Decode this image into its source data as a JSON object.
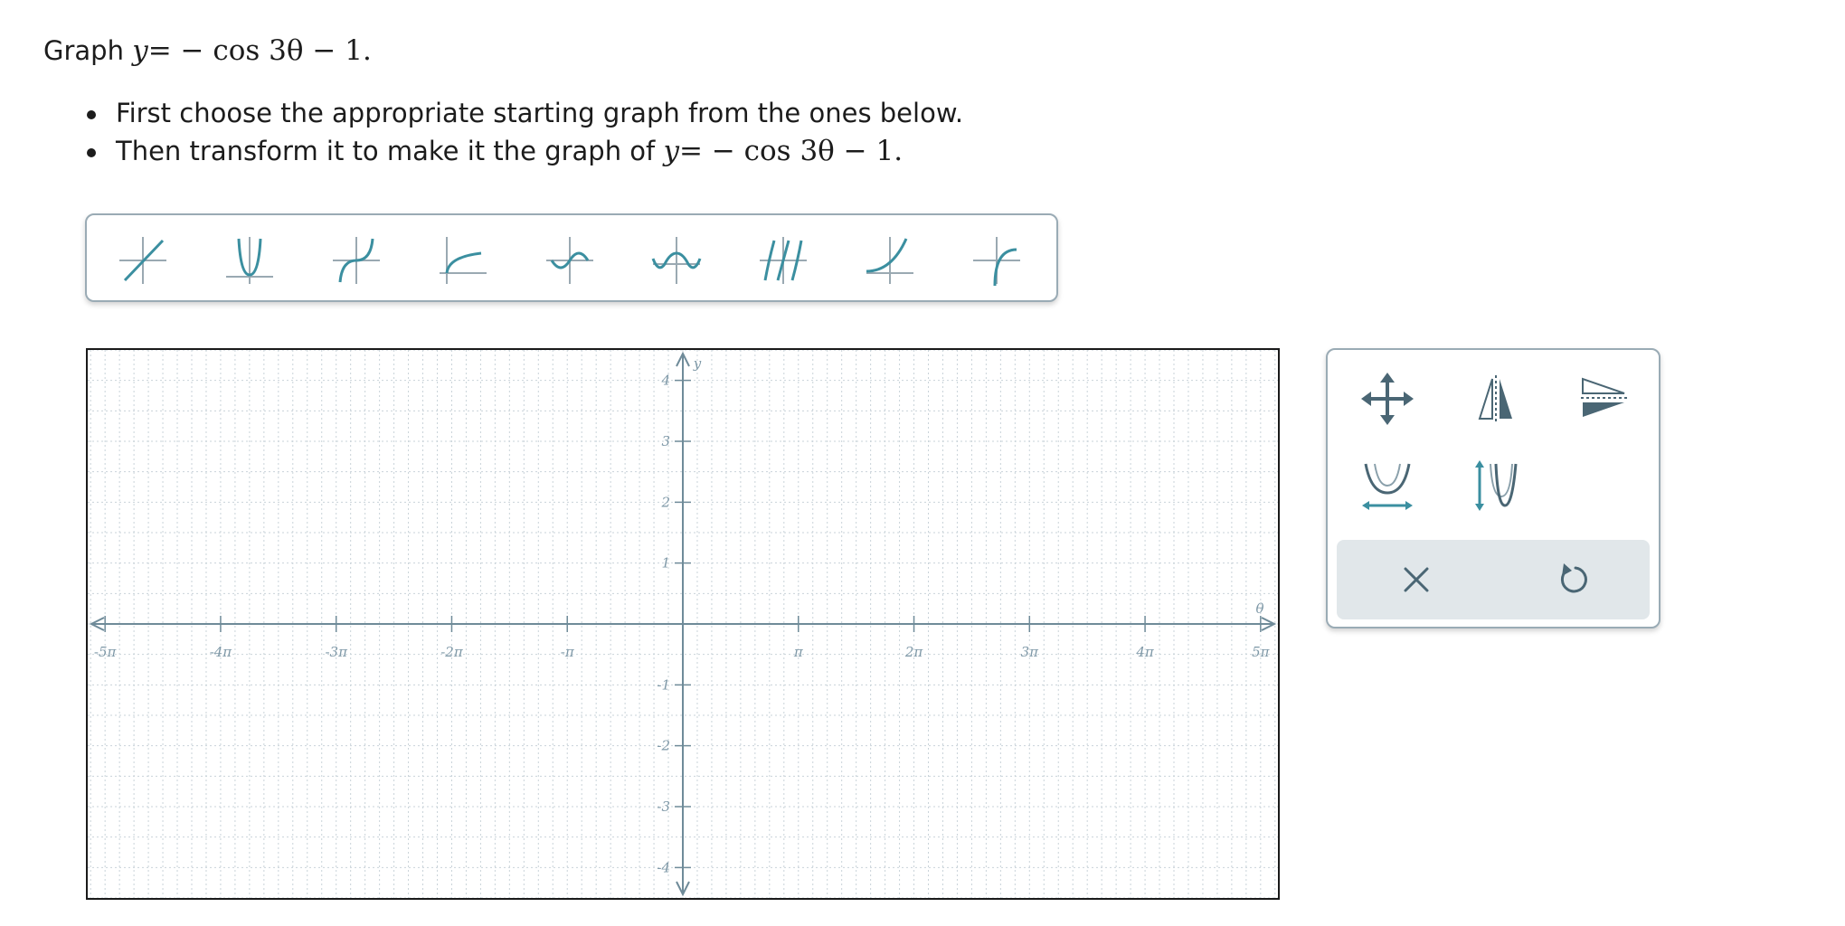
{
  "prompt": {
    "lead": "Graph",
    "equation": {
      "lhs": "y",
      "rhs": "= − cos 3θ − 1."
    }
  },
  "instructions": [
    {
      "text": "First choose the appropriate starting graph from the ones below."
    },
    {
      "text": "Then transform it to make it the graph of",
      "equation": {
        "lhs": "y",
        "rhs": "= − cos 3θ − 1."
      }
    }
  ],
  "palette": {
    "items": [
      {
        "icon": "linear-graph-icon"
      },
      {
        "icon": "parabola-graph-icon"
      },
      {
        "icon": "cubic-graph-icon"
      },
      {
        "icon": "square-root-graph-icon"
      },
      {
        "icon": "sine-graph-icon"
      },
      {
        "icon": "cosine-graph-icon"
      },
      {
        "icon": "tangent-graph-icon"
      },
      {
        "icon": "exponential-graph-icon"
      },
      {
        "icon": "logarithm-graph-icon"
      }
    ],
    "accent": "#3b8fa0"
  },
  "plot": {
    "x_axis_label": "θ",
    "y_axis_label": "y",
    "x_range": [
      -5.15,
      5.15
    ],
    "y_range": [
      -4.5,
      4.5
    ],
    "x_ticks": [
      {
        "value": -5,
        "label": "-5π"
      },
      {
        "value": -4,
        "label": "-4π"
      },
      {
        "value": -3,
        "label": "-3π"
      },
      {
        "value": -2,
        "label": "-2π"
      },
      {
        "value": -1,
        "label": "-π"
      },
      {
        "value": 1,
        "label": "π"
      },
      {
        "value": 2,
        "label": "2π"
      },
      {
        "value": 3,
        "label": "3π"
      },
      {
        "value": 4,
        "label": "4π"
      },
      {
        "value": 5,
        "label": "5π"
      }
    ],
    "y_ticks": [
      {
        "value": 4,
        "label": "4"
      },
      {
        "value": 3,
        "label": "3"
      },
      {
        "value": 2,
        "label": "2"
      },
      {
        "value": 1,
        "label": "1"
      },
      {
        "value": -1,
        "label": "-1"
      },
      {
        "value": -2,
        "label": "-2"
      },
      {
        "value": -3,
        "label": "-3"
      },
      {
        "value": -4,
        "label": "-4"
      }
    ],
    "x_minor_per_unit": 8,
    "y_minor_per_unit": 2,
    "grid": true,
    "axis_color": "#6f8b99",
    "grid_color": "#c9d3d9"
  },
  "tools": {
    "items": [
      {
        "icon": "move-icon"
      },
      {
        "icon": "reflect-vertical-axis-icon"
      },
      {
        "icon": "reflect-horizontal-axis-icon"
      },
      {
        "icon": "horizontal-stretch-icon"
      },
      {
        "icon": "vertical-stretch-icon"
      }
    ],
    "actions": [
      {
        "icon": "clear-icon"
      },
      {
        "icon": "undo-icon"
      }
    ],
    "icon_color": "#4a6674",
    "accent": "#3b8fa0"
  }
}
